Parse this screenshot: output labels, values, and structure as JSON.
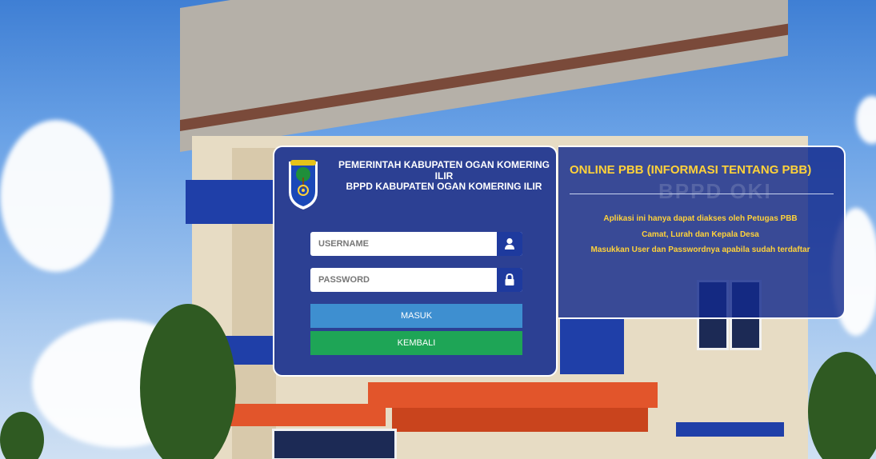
{
  "header": {
    "line1": "PEMERINTAH KABUPATEN OGAN KOMERING ILIR",
    "line2": "BPPD KABUPATEN OGAN KOMERING ILIR"
  },
  "login": {
    "username_placeholder": "USERNAME",
    "username_value": "",
    "password_placeholder": "PASSWORD",
    "password_value": "",
    "submit_label": "MASUK",
    "back_label": "KEMBALI"
  },
  "info": {
    "title": "ONLINE PBB (INFORMASI TENTANG PBB)",
    "lines": [
      "Aplikasi ini hanya dapat diakses oleh Petugas PBB",
      "Camat, Lurah dan Kepala Desa",
      "Masukkan User dan Passwordnya apabila sudah terdaftar"
    ],
    "background_sign": "BPPD OKI"
  },
  "colors": {
    "panel": "#122a8c",
    "accent_text": "#ffd23a",
    "button_login": "#3e8fd0",
    "button_back": "#1ea556",
    "icon_bg": "#1e3a9e"
  },
  "icons": {
    "username": "user-icon",
    "password": "lock-icon",
    "emblem": "ogan-komering-ilir-emblem"
  }
}
